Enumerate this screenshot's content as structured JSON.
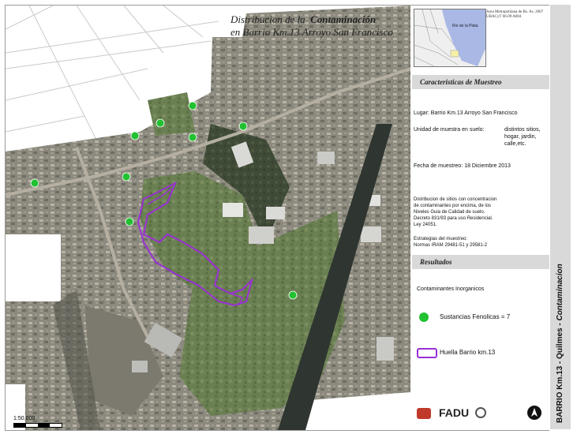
{
  "map": {
    "title_line1": "Distribucion de la",
    "title_emphasis": "Contaminación",
    "title_line2": "en Barrio Km.13  Arroyo San Francisco",
    "scale_label": "1:50.000",
    "sample_points_color": "#22c132",
    "footprint_color": "#9a2fd6"
  },
  "locator": {
    "water_label": "Rio de la Plata",
    "note_line1": "Area Metropolitana de Bs. As. 2007",
    "note_line2": "UBACyT 06-09   A004"
  },
  "panel": {
    "characteristics_header": "Caracteristicas de Muestreo",
    "lugar": "Lugar:  Barrio Km.13  Arroyo San Francisco",
    "unidad_label": "Unidad de muestra en suelo:",
    "unidad_values": [
      "distintos sitios,",
      "hogar,  jardin,",
      "calle,etc."
    ],
    "fecha": "Fecha de muestreo:  18 Diciembre 2013",
    "distribucion_lines": [
      "Distribucion de sitios con concentracion",
      "de contaminantes por encima, de los",
      "Niveles Guia de Calidad de suelo.",
      "Decreto 831/93 para uso Residencial.",
      "Ley 24051."
    ],
    "estrategias_lines": [
      "Estrategias del muestreo:",
      "Normas IRAM  29481-51 y 29581-2"
    ],
    "results_header": "Resultados",
    "contaminants_label": "Contaminantes Inorganicos",
    "legend_points": "Sustancias Fenolicas = 7",
    "legend_footprint": "Huella Barrio km.13",
    "logo_fadu": "FADU"
  },
  "side": {
    "label_main": "BARRIO Km.13 - Quilmes - ",
    "label_emphasis": "Contaminacion"
  },
  "sample_count": 7
}
